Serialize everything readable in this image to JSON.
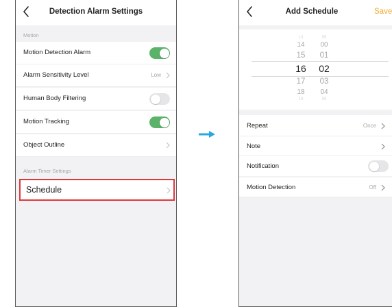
{
  "left_screen": {
    "title": "Detection Alarm Settings",
    "section_motion": "Motion",
    "rows": [
      {
        "label": "Motion Detection Alarm"
      },
      {
        "label": "Alarm Sensitivity Level",
        "value": "Low"
      },
      {
        "label": "Human Body Filtering"
      },
      {
        "label": "Motion Tracking"
      },
      {
        "label": "Object Outline"
      }
    ],
    "section_timer": "Alarm Timer Settings",
    "schedule_label": "Schedule"
  },
  "toggles": {
    "motion_detection_alarm": true,
    "human_body_filtering": false,
    "motion_tracking": true,
    "notification": false
  },
  "right_screen": {
    "title": "Add Schedule",
    "save_label": "Save",
    "picker": {
      "hours": [
        "13",
        "14",
        "15",
        "16",
        "17",
        "18",
        "19"
      ],
      "minutes": [
        "59",
        "00",
        "01",
        "02",
        "03",
        "04",
        "05"
      ],
      "selected_hour": "16",
      "selected_minute": "02"
    },
    "rows": [
      {
        "label": "Repeat",
        "value": "Once"
      },
      {
        "label": "Note"
      },
      {
        "label": "Notification"
      },
      {
        "label": "Motion Detection",
        "value": "Off"
      }
    ]
  },
  "colors": {
    "toggle_on": "#5bb36a",
    "toggle_off": "#e6e6e8",
    "save_accent": "#f2a92f",
    "highlight_border": "#e0373a",
    "arrow": "#29a8e0"
  },
  "icons": {
    "back": "chevron-left-icon",
    "disclosure": "chevron-right-icon",
    "transition": "arrow-right-icon"
  }
}
